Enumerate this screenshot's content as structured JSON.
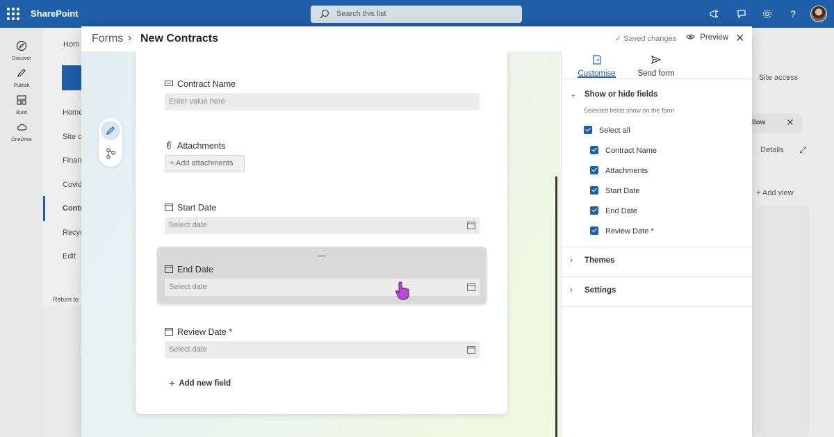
{
  "suitebar": {
    "app_name": "SharePoint",
    "search_placeholder": "Search this list",
    "icons": [
      "megaphone-icon",
      "feedback-icon",
      "gear-icon",
      "help-icon"
    ]
  },
  "app_rail": {
    "items": [
      {
        "label": "Discover",
        "icon": "compass-icon"
      },
      {
        "label": "Publish",
        "icon": "pen-icon"
      },
      {
        "label": "Build",
        "icon": "build-icon"
      },
      {
        "label": "OneDrive",
        "icon": "cloud-icon"
      }
    ]
  },
  "background_site": {
    "nav_items": [
      "Hom",
      "Home",
      "Site c",
      "Finan",
      "Covid",
      "Contr",
      "Recyc",
      "Edit",
      "Return to"
    ],
    "right_items": {
      "site_access": "Site access",
      "follow": "llow",
      "details": "Details",
      "add_view": "Add view"
    }
  },
  "modal": {
    "breadcrumb_root": "Forms",
    "breadcrumb_sep": "›",
    "breadcrumb_current": "New Contracts",
    "saved_status": "Saved changes",
    "preview_label": "Preview",
    "close_label": "✕"
  },
  "form": {
    "fields": [
      {
        "label": "Contract Name",
        "type": "text",
        "placeholder": "Enter value here",
        "icon": "text-field-icon"
      },
      {
        "label": "Attachments",
        "type": "attachment",
        "button": "Add attachments",
        "icon": "paperclip-icon"
      },
      {
        "label": "Start Date",
        "type": "date",
        "placeholder": "Select date",
        "icon": "calendar-icon"
      },
      {
        "label": "End Date",
        "type": "date",
        "placeholder": "Select date",
        "icon": "calendar-icon"
      },
      {
        "label": "Review Date *",
        "type": "date",
        "placeholder": "Select date",
        "icon": "calendar-icon"
      }
    ],
    "add_new_field": "Add new field"
  },
  "panel": {
    "tabs": [
      {
        "label": "Customise",
        "icon": "customise-icon",
        "active": true
      },
      {
        "label": "Send form",
        "icon": "send-icon",
        "active": false
      }
    ],
    "show_hide": {
      "title": "Show or hide fields",
      "subtitle": "Selected fields show on the form",
      "select_all": "Select all",
      "items": [
        "Contract Name",
        "Attachments",
        "Start Date",
        "End Date",
        "Review Date *"
      ]
    },
    "themes": "Themes",
    "settings": "Settings"
  },
  "colors": {
    "brand": "#1f5ea8",
    "checkbox": "#1f5ea8",
    "cursor": "#b84bd6"
  }
}
